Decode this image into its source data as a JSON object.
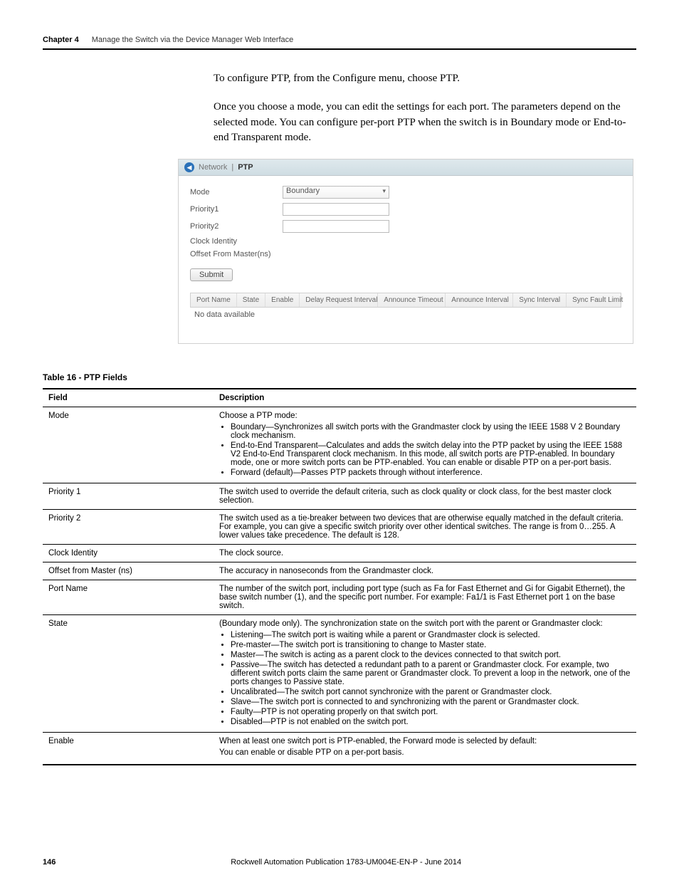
{
  "header": {
    "chapter": "Chapter 4",
    "title": "Manage the Switch via the Device Manager Web Interface"
  },
  "body": {
    "p1": "To configure PTP, from the Configure menu, choose PTP.",
    "p2": "Once you choose a mode, you can edit the settings for each port. The parameters depend on the selected mode. You can configure per-port PTP when the switch is in Boundary mode or End-to-end Transparent mode."
  },
  "screenshot": {
    "breadcrumb": {
      "section": "Network",
      "sep": " | ",
      "page": "PTP"
    },
    "fields": {
      "mode_label": "Mode",
      "mode_value": "Boundary",
      "priority1_label": "Priority1",
      "priority2_label": "Priority2",
      "clock_identity_label": "Clock Identity",
      "offset_label": "Offset From Master(ns)"
    },
    "submit": "Submit",
    "table": {
      "columns": [
        "Port Name",
        "State",
        "Enable",
        "Delay Request Interval",
        "Announce Timeout",
        "Announce Interval",
        "Sync Interval",
        "Sync Fault Limit"
      ],
      "empty": "No data available"
    }
  },
  "table_caption": "Table 16 - PTP Fields",
  "table_header": {
    "field": "Field",
    "description": "Description"
  },
  "rows": {
    "mode": {
      "field": "Mode",
      "intro": "Choose a PTP mode:",
      "b1": "Boundary—Synchronizes all switch ports with the Grandmaster clock by using the IEEE 1588 V 2 Boundary clock mechanism.",
      "b2": "End-to-End Transparent—Calculates and adds the switch delay into the PTP packet by using the IEEE 1588 V2 End-to-End Transparent clock mechanism. In this mode, all switch ports are PTP-enabled. In boundary mode, one or more switch ports can be PTP-enabled. You can enable or disable PTP on a per-port basis.",
      "b3": "Forward (default)—Passes PTP packets through without interference."
    },
    "priority1": {
      "field": "Priority 1",
      "desc": "The switch used to override the default criteria, such as clock quality or clock class, for the best master clock selection."
    },
    "priority2": {
      "field": "Priority 2",
      "desc": "The switch used as a tie-breaker between two devices that are otherwise equally matched in the default criteria. For example, you can give a specific switch priority over other identical switches. The range is from 0…255. A lower values take precedence. The default is 128."
    },
    "clock_identity": {
      "field": "Clock Identity",
      "desc": "The clock source."
    },
    "offset": {
      "field": "Offset from Master (ns)",
      "desc": "The accuracy in nanoseconds from the Grandmaster clock."
    },
    "portname": {
      "field": "Port Name",
      "desc": "The number of the switch port, including port type (such as Fa for Fast Ethernet and Gi for Gigabit Ethernet), the base switch number (1), and the specific port number. For example: Fa1/1 is Fast Ethernet port 1 on the base switch."
    },
    "state": {
      "field": "State",
      "intro": "(Boundary mode only). The synchronization state on the switch port with the parent or Grandmaster clock:",
      "b1": "Listening—The switch port is waiting while a parent or Grandmaster clock is selected.",
      "b2": "Pre-master—The switch port is transitioning to change to Master state.",
      "b3": "Master—The switch is acting as a parent clock to the devices connected to that switch port.",
      "b4": "Passive—The switch has detected a redundant path to a parent or Grandmaster clock. For example, two different switch ports claim the same parent or Grandmaster clock. To prevent a loop in the network, one of the ports changes to Passive state.",
      "b5": "Uncalibrated—The switch port cannot synchronize with the parent or Grandmaster clock.",
      "b6": "Slave—The switch port is connected to and synchronizing with the parent or Grandmaster clock.",
      "b7": "Faulty—PTP is not operating properly on that switch port.",
      "b8": "Disabled—PTP is not enabled on the switch port."
    },
    "enable": {
      "field": "Enable",
      "l1": "When at least one switch port is PTP-enabled, the Forward mode is selected by default:",
      "l2": "You can enable or disable PTP on a per-port basis."
    }
  },
  "footer": {
    "pagenum": "146",
    "pub": "Rockwell Automation Publication 1783-UM004E-EN-P - June 2014"
  }
}
